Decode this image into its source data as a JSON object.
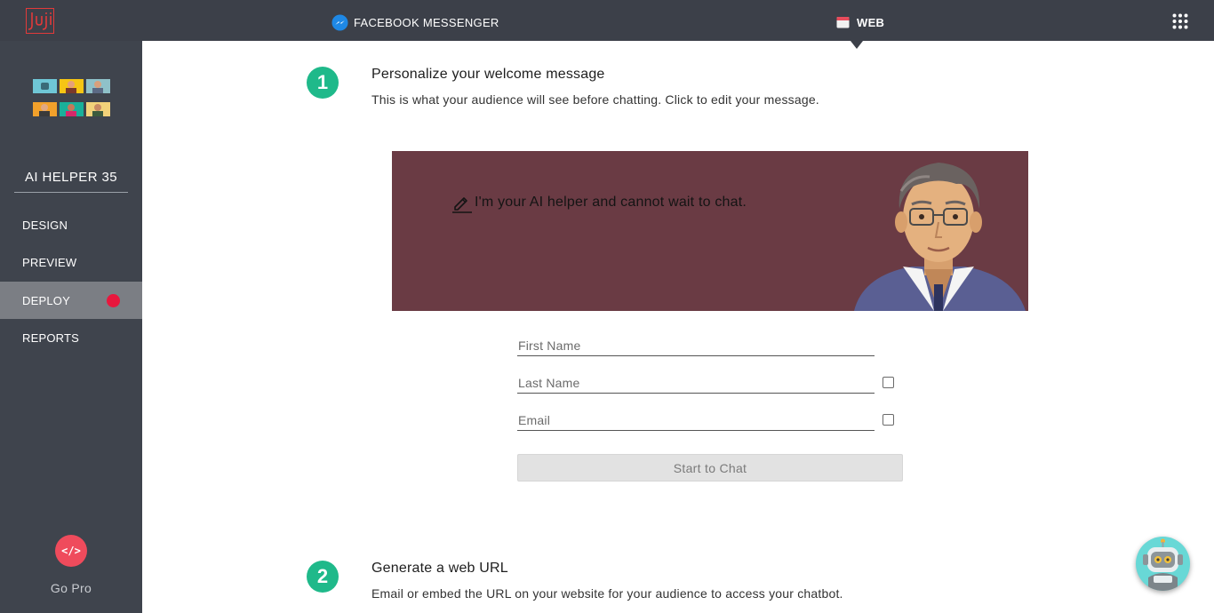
{
  "app": {
    "logo_text": "Juji"
  },
  "topbar": {
    "tabs": [
      {
        "label": "FACEBOOK MESSENGER",
        "icon": "messenger-icon"
      },
      {
        "label": "WEB",
        "icon": "calendar-icon"
      }
    ],
    "apps_icon": "grid-icon"
  },
  "sidebar": {
    "bot_name": "AI HELPER 35",
    "nav": [
      {
        "label": "DESIGN"
      },
      {
        "label": "PREVIEW"
      },
      {
        "label": "DEPLOY",
        "active": true
      },
      {
        "label": "REPORTS"
      }
    ],
    "go_pro": {
      "icon_text": "</>",
      "label": "Go Pro"
    }
  },
  "main": {
    "step1": {
      "number": "1",
      "title": "Personalize your welcome message",
      "description": "This is what your audience will see before chatting. Click to edit your message."
    },
    "banner": {
      "message": "I'm your AI helper and cannot wait to chat.",
      "background": "#6a3b44"
    },
    "form": {
      "first_name_placeholder": "First Name",
      "last_name_placeholder": "Last Name",
      "email_placeholder": "Email",
      "start_button": "Start to Chat"
    },
    "step2": {
      "number": "2",
      "title": "Generate a web URL",
      "description": "Email or embed the URL on your website for your audience to access your chatbot."
    }
  },
  "colors": {
    "topbar": "#3c4049",
    "sidebar": "#3f444d",
    "accent_green": "#1fb98a",
    "status_red": "#e8173d",
    "go_pro_red": "#ef4b5c"
  }
}
